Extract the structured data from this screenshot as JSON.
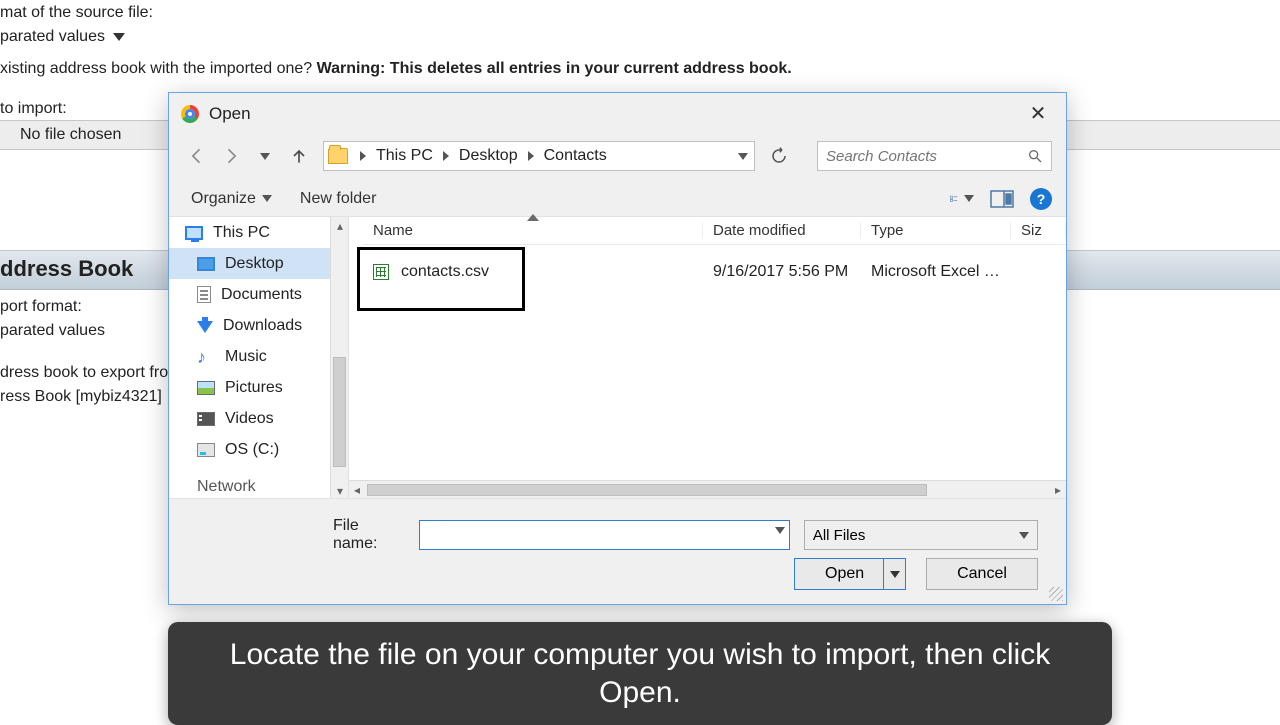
{
  "background": {
    "format_label": "mat of the source file:",
    "format_value": "parated values",
    "replace_question": "xisting address book with the imported one? ",
    "warning_text": "Warning: This deletes all entries in your current address book.",
    "import_label": "to import:",
    "no_file_chosen": "No file chosen",
    "heading": "ddress Book",
    "export_format_label": "port format:",
    "export_format_value": "parated values",
    "export_book_label": "dress book to export fro",
    "export_book_value": "ress Book [mybiz4321]"
  },
  "dialog": {
    "title": "Open",
    "breadcrumb": [
      "This PC",
      "Desktop",
      "Contacts"
    ],
    "search_placeholder": "Search Contacts",
    "organize_label": "Organize",
    "new_folder_label": "New folder",
    "help_char": "?",
    "tree": {
      "root": "This PC",
      "items": [
        "Desktop",
        "Documents",
        "Downloads",
        "Music",
        "Pictures",
        "Videos",
        "OS (C:)"
      ],
      "partial": "Network"
    },
    "columns": {
      "name": "Name",
      "date": "Date modified",
      "type": "Type",
      "size": "Siz"
    },
    "file": {
      "name": "contacts.csv",
      "date": "9/16/2017 5:56 PM",
      "type": "Microsoft Excel C…"
    },
    "filename_label": "File name:",
    "filetype_value": "All Files",
    "open_label": "Open",
    "cancel_label": "Cancel"
  },
  "caption": "Locate the file on your computer you wish to import, then click Open."
}
